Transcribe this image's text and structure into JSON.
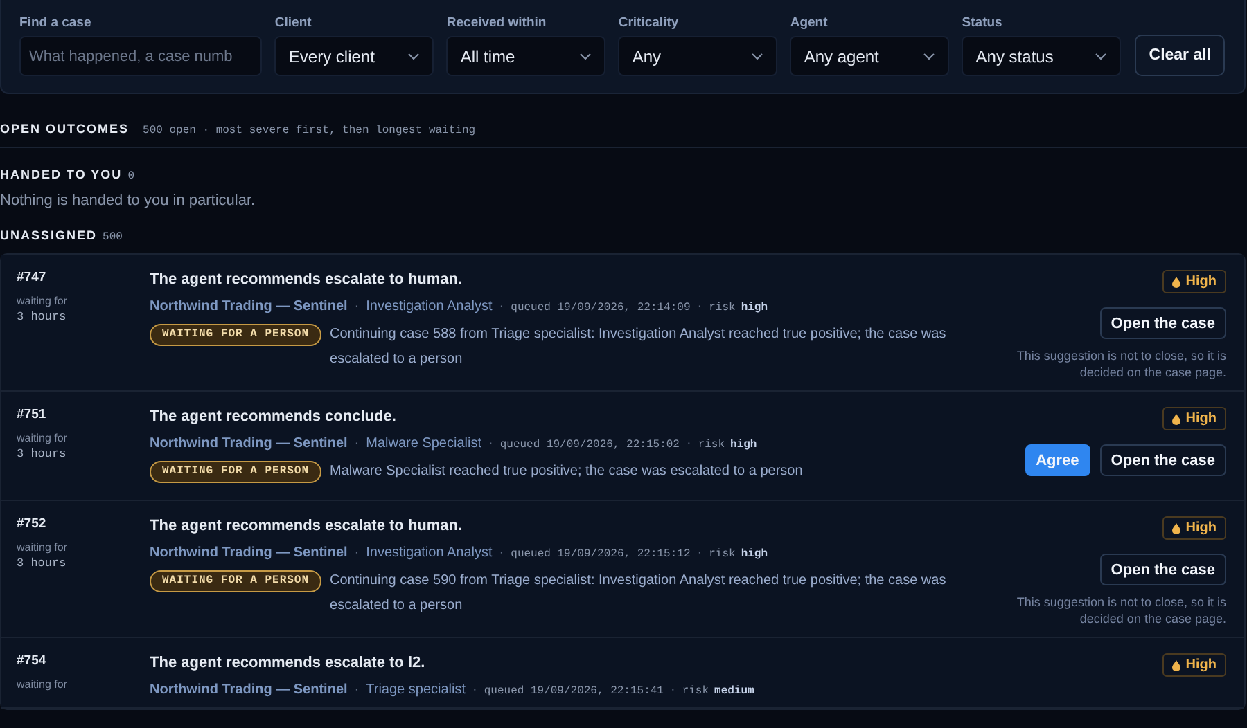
{
  "filters": [
    {
      "kind": "search",
      "label": "Find a case",
      "placeholder": "What happened, a case numb"
    },
    {
      "kind": "select",
      "label": "Client",
      "value": "Every client"
    },
    {
      "kind": "select",
      "label": "Received within",
      "value": "All time"
    },
    {
      "kind": "select",
      "label": "Criticality",
      "value": "Any"
    },
    {
      "kind": "select",
      "label": "Agent",
      "value": "Any agent"
    },
    {
      "kind": "select",
      "label": "Status",
      "value": "Any status"
    }
  ],
  "clear_button": "Clear all",
  "meta_separator": "·",
  "outcomes": {
    "title": "OPEN OUTCOMES",
    "summary": "500 open · most severe first, then longest waiting"
  },
  "handed": {
    "title": "HANDED TO YOU",
    "count": "0",
    "empty_text": "Nothing is handed to you in particular."
  },
  "unassigned": {
    "title": "UNASSIGNED",
    "count": "500"
  },
  "cases": [
    {
      "id": "#747",
      "waiting_label": "waiting for",
      "waiting_value": "3 hours",
      "title": "The agent recommends escalate to human.",
      "client": "Northwind Trading — Sentinel",
      "agent": "Investigation Analyst",
      "queued": "queued 19/09/2026, 22:14:09",
      "risk_label": "risk",
      "risk": "high",
      "status": "WAITING FOR A PERSON",
      "description": "Continuing case 588 from Triage specialist: Investigation Analyst reached true positive; the case was escalated to a person",
      "severity": "High",
      "actions": [
        {
          "kind": "secondary",
          "label": "Open the case"
        }
      ],
      "note": "This suggestion is not to close, so it is decided on the case page."
    },
    {
      "id": "#751",
      "waiting_label": "waiting for",
      "waiting_value": "3 hours",
      "title": "The agent recommends conclude.",
      "client": "Northwind Trading — Sentinel",
      "agent": "Malware Specialist",
      "queued": "queued 19/09/2026, 22:15:02",
      "risk_label": "risk",
      "risk": "high",
      "status": "WAITING FOR A PERSON",
      "description": "Malware Specialist reached true positive; the case was escalated to a person",
      "severity": "High",
      "actions": [
        {
          "kind": "primary",
          "label": "Agree"
        },
        {
          "kind": "secondary",
          "label": "Open the case"
        }
      ]
    },
    {
      "id": "#752",
      "waiting_label": "waiting for",
      "waiting_value": "3 hours",
      "title": "The agent recommends escalate to human.",
      "client": "Northwind Trading — Sentinel",
      "agent": "Investigation Analyst",
      "queued": "queued 19/09/2026, 22:15:12",
      "risk_label": "risk",
      "risk": "high",
      "status": "WAITING FOR A PERSON",
      "description": "Continuing case 590 from Triage specialist: Investigation Analyst reached true positive; the case was escalated to a person",
      "severity": "High",
      "actions": [
        {
          "kind": "secondary",
          "label": "Open the case"
        }
      ],
      "note": "This suggestion is not to close, so it is decided on the case page."
    },
    {
      "id": "#754",
      "waiting_label": "waiting for",
      "title": "The agent recommends escalate to l2.",
      "client": "Northwind Trading — Sentinel",
      "agent": "Triage specialist",
      "queued": "queued 19/09/2026, 22:15:41",
      "risk_label": "risk",
      "risk": "medium",
      "severity": "High"
    }
  ]
}
